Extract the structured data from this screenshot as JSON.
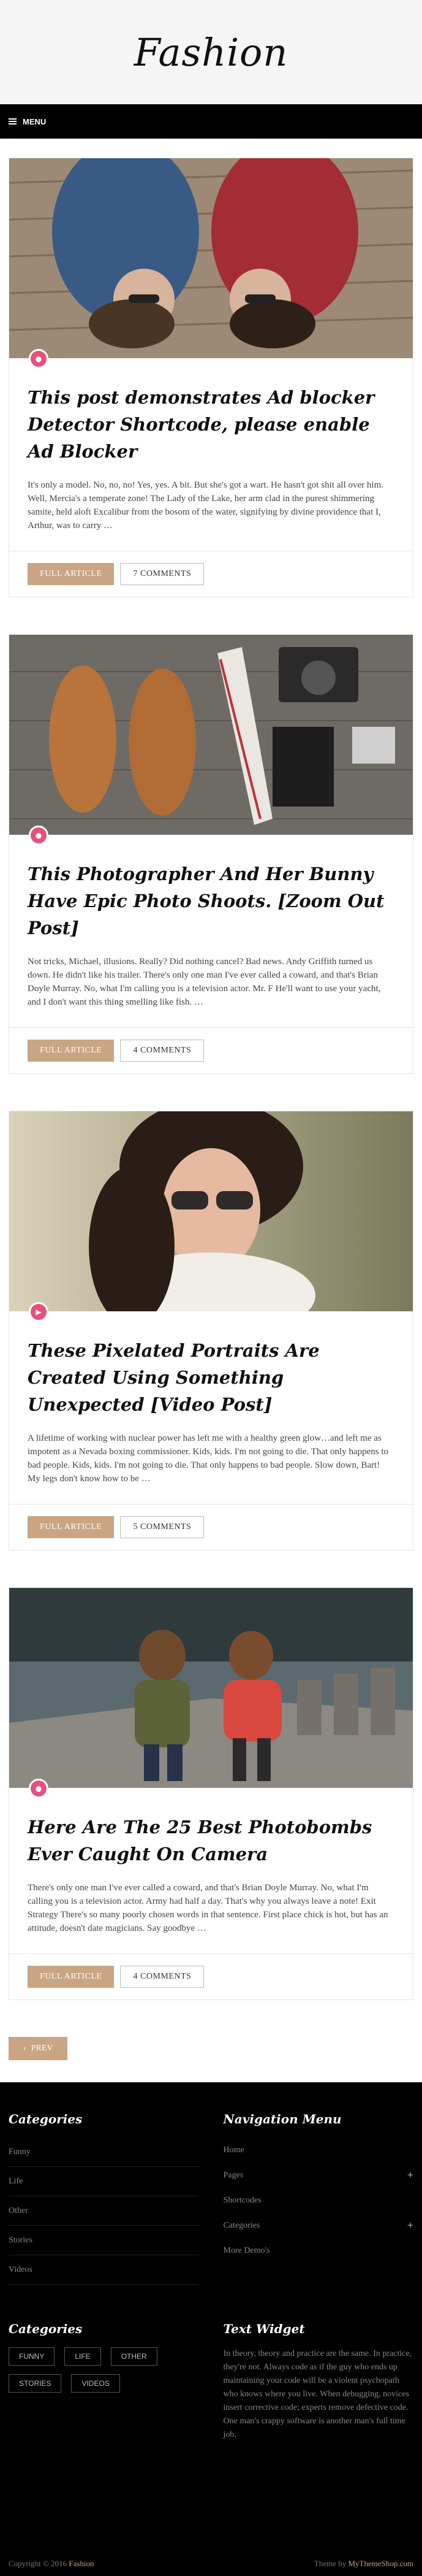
{
  "header": {
    "logo": "Fashion"
  },
  "menu": {
    "label": "MENU"
  },
  "posts": [
    {
      "title": "This post demonstrates Ad blocker Detector Shortcode, please enable Ad Blocker",
      "excerpt": "It's only a model. No, no, no! Yes, yes. A bit. But she's got a wart. He hasn't got shit all over him. Well, Mercia's a temperate zone! The Lady of the Lake, her arm clad in the purest shimmering samite, held aloft Excalibur from the bosom of the water, signifying by divine providence that I, Arthur, was to carry …",
      "read_label": "FULL ARTICLE",
      "comments": "7 COMMENTS",
      "format_icon": "document-icon"
    },
    {
      "title": "This Photographer And Her Bunny Have Epic Photo Shoots. [Zoom Out Post]",
      "excerpt": "Not tricks, Michael, illusions. Really? Did nothing cancel? Bad news. Andy Griffith turned us down. He didn't like his trailer. There's only one man I've ever called a coward, and that's Brian Doyle Murray. No, what I'm calling you is a television actor. Mr. F He'll want to use your yacht, and I don't want this thing smelling like fish. …",
      "read_label": "FULL ARTICLE",
      "comments": "4 COMMENTS",
      "format_icon": "document-icon"
    },
    {
      "title": "These Pixelated Portraits Are Created Using Something Unexpected [Video Post]",
      "excerpt": "A lifetime of working with nuclear power has left me with a healthy green glow…and left me as impotent as a Nevada boxing commissioner. Kids, kids. I'm not going to die. That only happens to bad people. Kids, kids. I'm not going to die. That only happens to bad people. Slow down, Bart! My legs don't know how to be …",
      "read_label": "FULL ARTICLE",
      "comments": "5 COMMENTS",
      "format_icon": "video-icon"
    },
    {
      "title": "Here Are The 25 Best Photobombs Ever Caught On Camera",
      "excerpt": "There's only one man I've ever called a coward, and that's Brian Doyle Murray. No, what I'm calling you is a television actor. Army had half a day. That's why you always leave a note! Exit Strategy There's so many poorly chosen words in that sentence. First place chick is hot, but has an attitude, doesn't date magicians. Say goodbye …",
      "read_label": "FULL ARTICLE",
      "comments": "4 COMMENTS",
      "format_icon": "document-icon"
    }
  ],
  "pagination": {
    "prev_label": "PREV"
  },
  "footer": {
    "categories_title": "Categories",
    "categories": [
      "Funny",
      "Life",
      "Other",
      "Stories",
      "Videos"
    ],
    "nav_title": "Navigation Menu",
    "nav_items": [
      {
        "label": "Home",
        "expandable": false
      },
      {
        "label": "Pages",
        "expandable": true
      },
      {
        "label": "Shortcodes",
        "expandable": false
      },
      {
        "label": "Categories",
        "expandable": true
      },
      {
        "label": "More Demo's",
        "expandable": false
      }
    ],
    "tags_title": "Categories",
    "tags": [
      "FUNNY",
      "LIFE",
      "OTHER",
      "STORIES",
      "VIDEOS"
    ],
    "text_title": "Text Widget",
    "text_body": "In theory, theory and practice are the same. In practice, they're not. Always code as if the guy who ends up maintaining your code will be a violent psychopath who knows where you live. When debugging, novices insert corrective code; experts remove defective code. One man's crappy software is another man's full time job.",
    "copyright_prefix": "Copyright © 2016",
    "copyright_site": "Fashion",
    "theme_prefix": "Theme by",
    "theme_link": "MyThemeShop.com"
  },
  "colors": {
    "accent": "#c9a583",
    "badge": "#e8507b",
    "footer_bg": "#000000"
  }
}
